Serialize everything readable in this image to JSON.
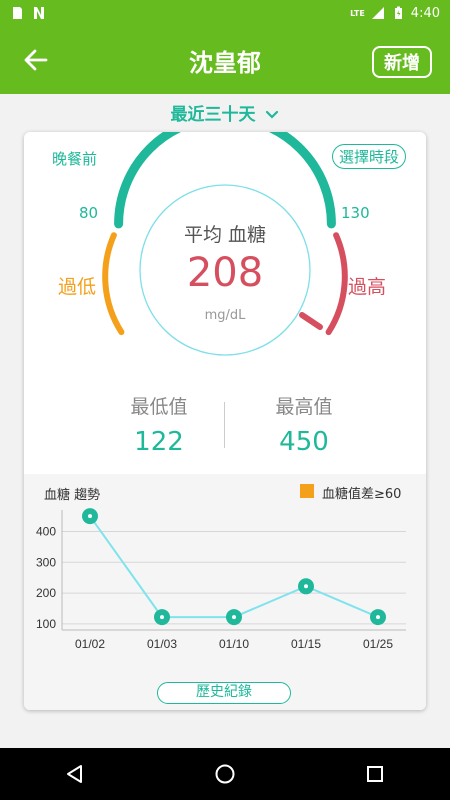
{
  "status_bar": {
    "time": "4:40",
    "network": "LTE"
  },
  "header": {
    "title": "沈皇郁",
    "add_label": "新增"
  },
  "period": {
    "label": "最近三十天",
    "icon": "chevron-down-icon"
  },
  "summary": {
    "meal_label": "晚餐前",
    "select_period_label": "選擇時段",
    "low_threshold": "80",
    "high_threshold": "130",
    "low_label": "過低",
    "high_label": "過高",
    "avg_label": "平均 血糖",
    "avg_value": "208",
    "unit": "mg/dL",
    "min_label": "最低值",
    "min_value": "122",
    "max_label": "最高值",
    "max_value": "450",
    "colors": {
      "accent": "#1fb89a",
      "low": "#f5a01a",
      "high": "#d64f5f",
      "brand": "#66bb1e"
    }
  },
  "trend": {
    "title": "血糖 趨勢",
    "legend_label": "血糖值差≥60",
    "history_label": "歷史紀錄"
  },
  "chart_data": {
    "type": "line",
    "categories": [
      "01/02",
      "01/03",
      "01/10",
      "01/15",
      "01/25"
    ],
    "series": [
      {
        "values": [
          450,
          122,
          122,
          222,
          122
        ]
      }
    ],
    "yticks": [
      100,
      200,
      300,
      400
    ],
    "ylim": [
      80,
      470
    ],
    "grid": true,
    "legend": "top-right"
  }
}
